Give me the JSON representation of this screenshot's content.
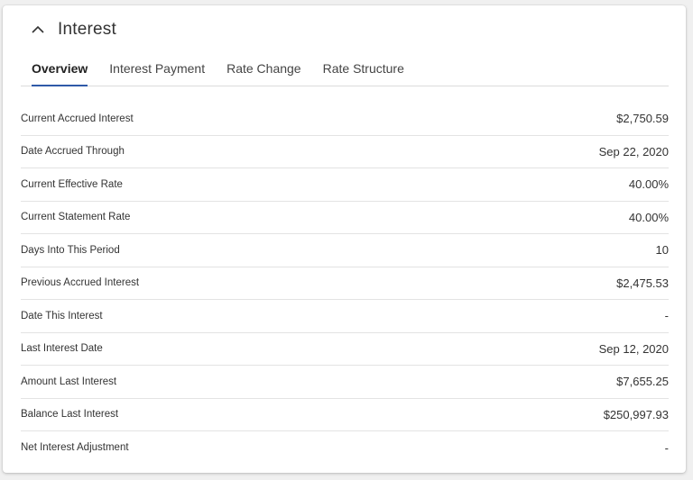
{
  "panel": {
    "title": "Interest",
    "toggle_icon": "chevron-up-icon"
  },
  "tabs": [
    {
      "label": "Overview",
      "active": true
    },
    {
      "label": "Interest Payment",
      "active": false
    },
    {
      "label": "Rate Change",
      "active": false
    },
    {
      "label": "Rate Structure",
      "active": false
    }
  ],
  "rows": [
    {
      "label": "Current Accrued Interest",
      "value": "$2,750.59"
    },
    {
      "label": "Date Accrued Through",
      "value": "Sep 22, 2020"
    },
    {
      "label": "Current Effective Rate",
      "value": "40.00%"
    },
    {
      "label": "Current Statement Rate",
      "value": "40.00%"
    },
    {
      "label": "Days Into This Period",
      "value": "10"
    },
    {
      "label": "Previous Accrued Interest",
      "value": "$2,475.53"
    },
    {
      "label": "Date This Interest",
      "value": "-"
    },
    {
      "label": "Last Interest Date",
      "value": "Sep 12, 2020"
    },
    {
      "label": "Amount Last Interest",
      "value": "$7,655.25"
    },
    {
      "label": "Balance Last Interest",
      "value": "$250,997.93"
    },
    {
      "label": "Net Interest Adjustment",
      "value": "-"
    }
  ],
  "colors": {
    "accent": "#2f5aa8",
    "divider": "#e3e3e3",
    "text": "#333333"
  }
}
